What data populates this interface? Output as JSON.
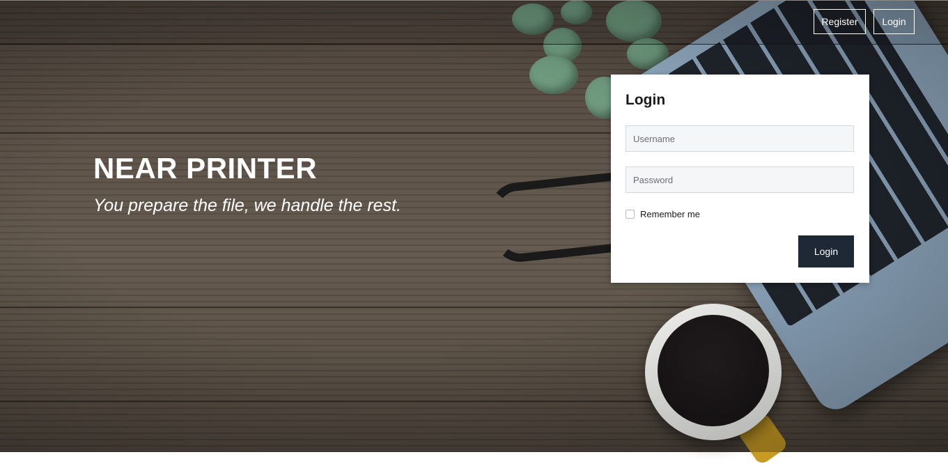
{
  "nav": {
    "register_label": "Register",
    "login_label": "Login"
  },
  "hero": {
    "title": "NEAR PRINTER",
    "tagline": "You prepare the file, we handle the rest."
  },
  "login_form": {
    "title": "Login",
    "username": {
      "placeholder": "Username",
      "value": ""
    },
    "password": {
      "placeholder": "Password",
      "value": ""
    },
    "remember_label": "Remember me",
    "remember_checked": false,
    "submit_label": "Login"
  },
  "colors": {
    "button_dark": "#1f2835",
    "card_bg": "#ffffff",
    "field_bg": "#f5f6f8"
  }
}
